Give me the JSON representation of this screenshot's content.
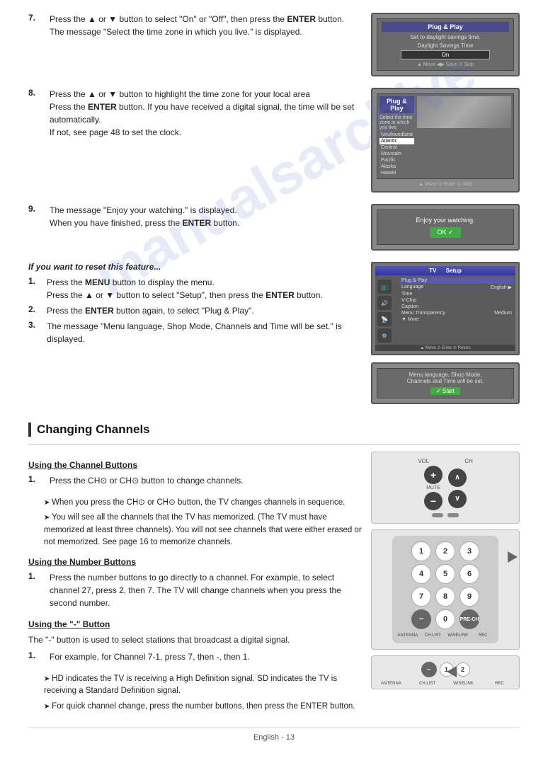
{
  "page": {
    "footer": "English - 13"
  },
  "section7": {
    "num": "7.",
    "text": "Press the ▲ or ▼ button to select \"On\" or \"Off\", then press the ",
    "bold": "ENTER",
    "text2": " button.",
    "text3": "The message \"Select the time zone in which you live.\" is displayed.",
    "screen_title": "Plug & Play",
    "screen_sub": "Set to daylight savings time.",
    "screen_label": "Daylight Savings Time",
    "screen_highlight": "On",
    "screen_footer": "▲ Move   ◀▶ Save   ⊙ Skip"
  },
  "section8": {
    "num": "8.",
    "text": "Press the ▲ or ▼ button to highlight the time zone for your local area",
    "text2": "Press the ",
    "bold": "ENTER",
    "text3": " button. If you have received a digital signal, the time will be set automatically.",
    "text4": "If not, see page 48 to set the clock.",
    "screen_title": "Plug & Play",
    "screen_sub": "Select the time zone in which you live.",
    "zones": [
      "Newfoundland",
      "Atlantic",
      "Central",
      "Mountain",
      "Pacific",
      "Alaska",
      "Hawaii"
    ],
    "selected": "Atlantic"
  },
  "section9": {
    "num": "9.",
    "text": "The message \"Enjoy your watching.\" is displayed.",
    "text2": "When you have finished, press the ",
    "bold": "ENTER",
    "text3": " button.",
    "screen_msg": "Enjoy your watching.",
    "screen_btn": "OK ✓"
  },
  "reset": {
    "title": "If you want to reset this feature...",
    "steps": [
      {
        "num": "1.",
        "text": "Press the ",
        "bold1": "MENU",
        "text2": " button to display the menu.",
        "text3": "Press the ▲ or ▼ button to select \"Setup\", then press the ",
        "bold2": "ENTER",
        "text4": " button."
      },
      {
        "num": "2.",
        "text": "Press the ",
        "bold1": "ENTER",
        "text2": " button again, to select \"Plug & Play\"."
      },
      {
        "num": "3.",
        "text": "The message \"Menu language, Shop Mode, Channels and Time will be set.\" is displayed."
      }
    ],
    "screen1_title": "TV",
    "screen1_sub": "Setup",
    "menu_items": [
      "Plug & Play",
      "Language",
      "Time",
      "V-Chip",
      "Caption",
      "Menu Transparency : Medium",
      "▼ More"
    ],
    "screen2_msg": "Menu language, Shop Mode,",
    "screen2_msg2": "Channels and Time will be set.",
    "screen2_btn": "✓ Start"
  },
  "changing_channels": {
    "section_title": "Changing Channels",
    "subsections": {
      "channel_buttons": {
        "title": "Using the Channel Buttons",
        "step1_num": "1.",
        "step1_text": "Press the CH⊙ or CH⊙ button to change channels.",
        "note1": "When you press the CH⊙ or CH⊙ button, the TV changes channels in sequence.",
        "note2": "You will see all the channels that the TV has memorized. (The TV must have memorized at least three channels). You will not see channels that were either erased or not memorized. See page 16 to memorize channels."
      },
      "number_buttons": {
        "title": "Using the Number Buttons",
        "step1_num": "1.",
        "step1_text": "Press the number buttons to go directly to a channel. For example, to select channel 27, press 2, then 7. The TV will change channels when you press the second number."
      },
      "dash_button": {
        "title": "Using the \"-\" Button",
        "intro": "The \"-\" button is used to select stations that broadcast a digital signal.",
        "step1_num": "1.",
        "step1_text": "For example, for Channel 7-1, press 7, then -, then 1.",
        "note1": "HD indicates the TV is receiving a High Definition signal. SD indicates the TV is receiving a Standard Definition signal.",
        "note2": "For quick channel change, press the number buttons, then press the ENTER button."
      }
    }
  },
  "remote": {
    "vol_label": "VOL",
    "ch_label": "CH",
    "mute_label": "MUTE",
    "numpad": [
      "1",
      "2",
      "3",
      "4",
      "5",
      "6",
      "7",
      "8",
      "9",
      "-",
      "0",
      "PRE-CH"
    ],
    "bottom_labels": [
      "ANTENNA",
      "CH.LIST",
      "WISELINK",
      "REC"
    ]
  }
}
